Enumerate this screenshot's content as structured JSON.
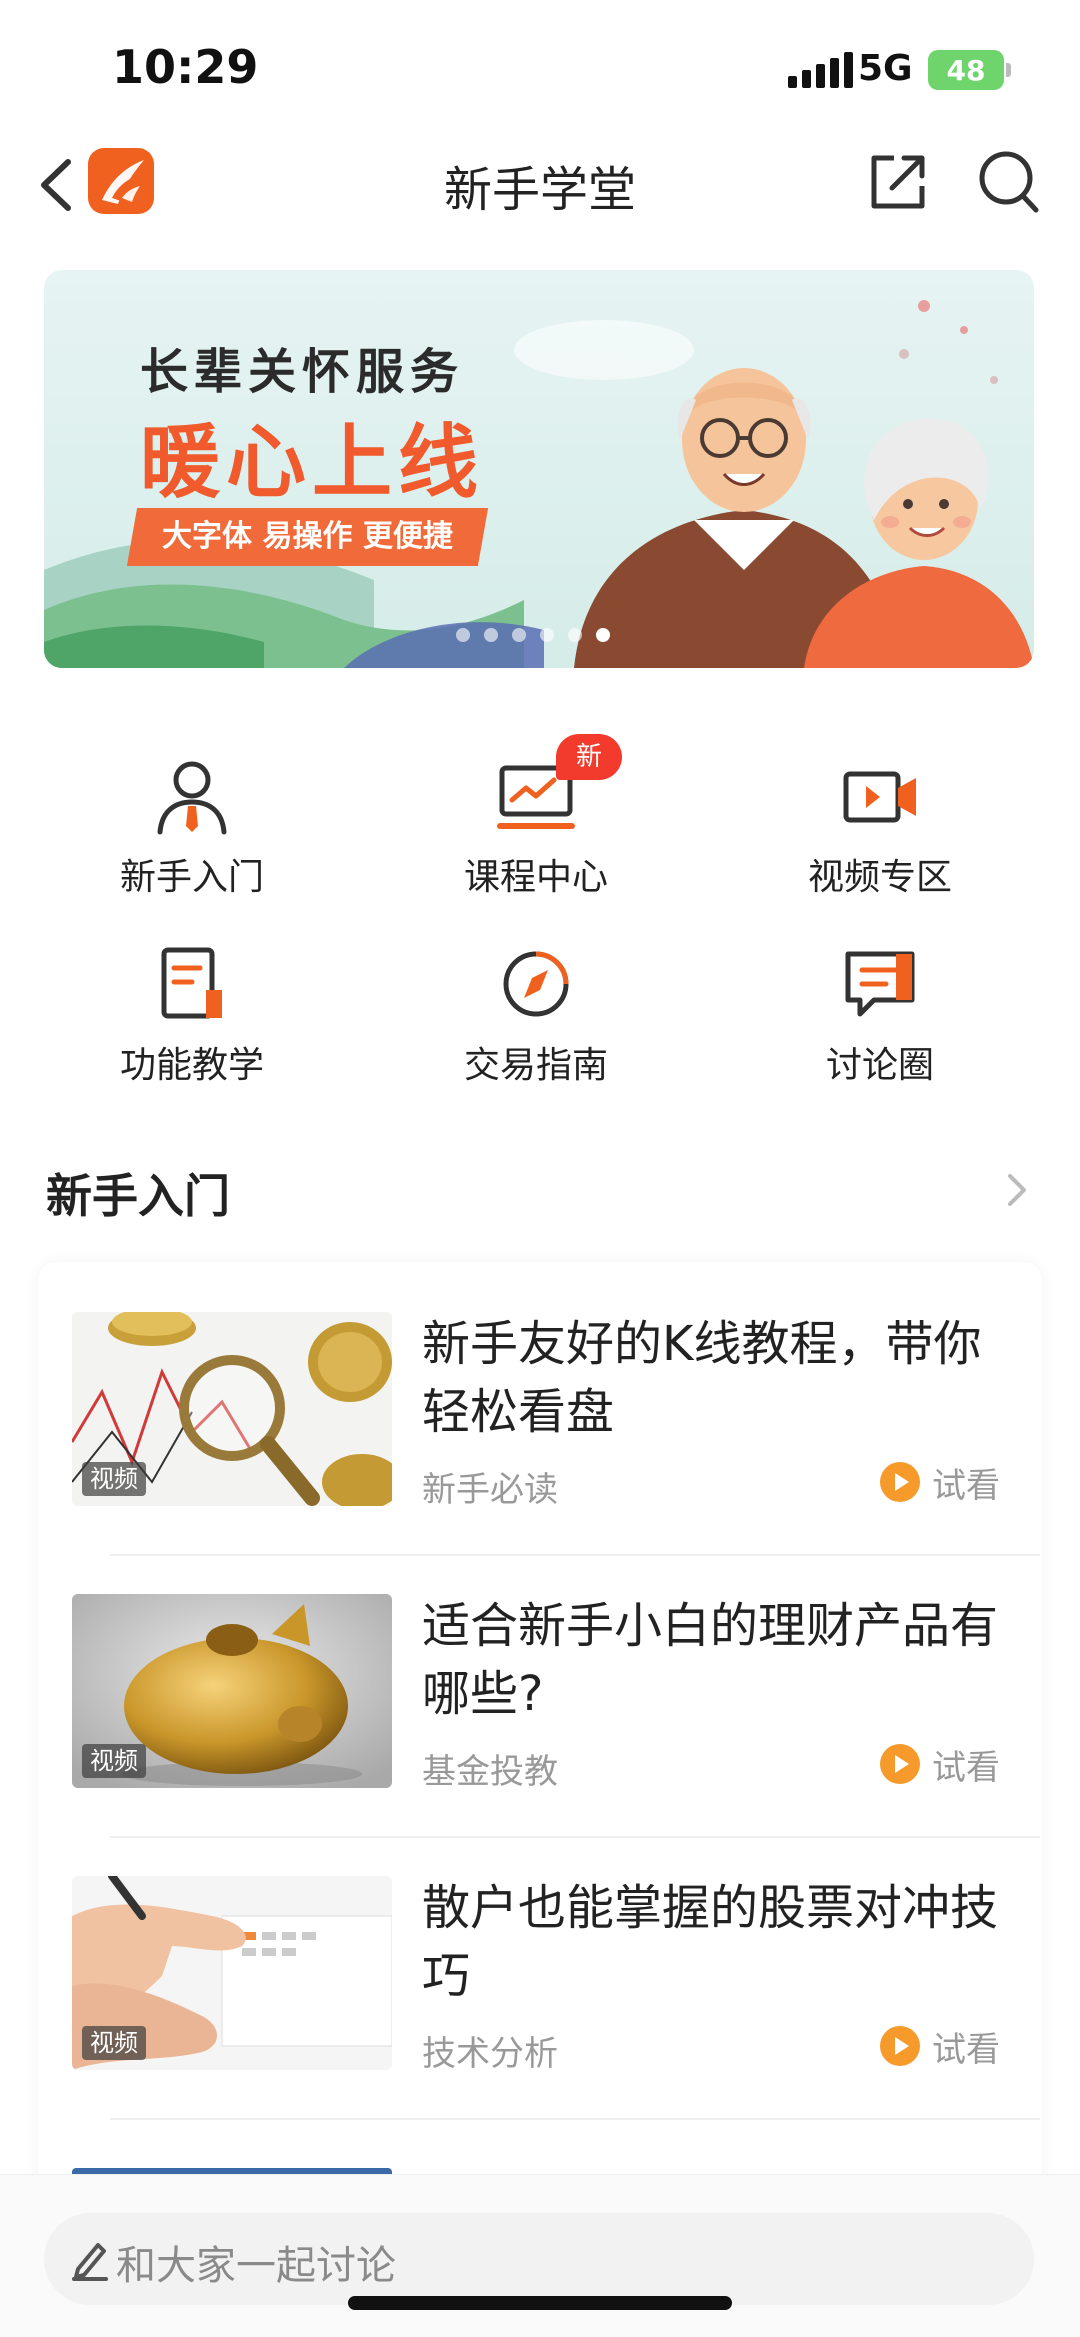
{
  "status_bar": {
    "time": "10:29",
    "network": "5G",
    "battery": "48"
  },
  "nav": {
    "title": "新手学堂"
  },
  "banner": {
    "line1": "长辈关怀服务",
    "line2": "暖心上线",
    "line3": "大字体 易操作 更便捷",
    "slide_count": 6,
    "active_slide": 6
  },
  "quick_menu": [
    {
      "label": "新手入门",
      "icon": "person-icon"
    },
    {
      "label": "课程中心",
      "icon": "course-chart-icon",
      "badge": "新"
    },
    {
      "label": "视频专区",
      "icon": "video-camera-icon"
    },
    {
      "label": "功能教学",
      "icon": "document-icon"
    },
    {
      "label": "交易指南",
      "icon": "compass-icon"
    },
    {
      "label": "讨论圈",
      "icon": "chat-bubble-icon"
    }
  ],
  "section": {
    "title": "新手入门"
  },
  "articles": [
    {
      "title": "新手友好的K线教程，带你轻松看盘",
      "tag": "新手必读",
      "thumb_tag": "视频",
      "action": "试看"
    },
    {
      "title": "适合新手小白的理财产品有哪些?",
      "tag": "基金投教",
      "thumb_tag": "视频",
      "action": "试看"
    },
    {
      "title": "散户也能掌握的股票对冲技巧",
      "tag": "技术分析",
      "thumb_tag": "视频",
      "action": "试看"
    }
  ],
  "comment": {
    "placeholder": "和大家一起讨论"
  },
  "colors": {
    "accent": "#f0601e",
    "badge": "#f23b2c",
    "play": "#f59a2b",
    "text": "#222222",
    "muted": "#999999"
  }
}
